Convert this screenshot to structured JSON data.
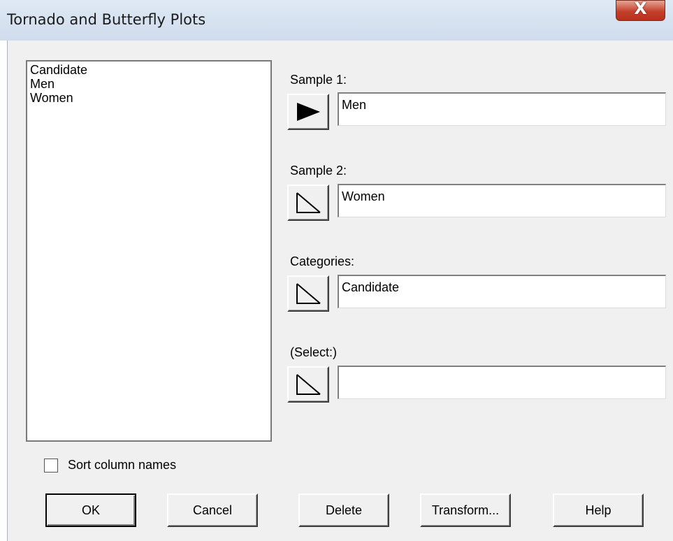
{
  "window": {
    "title": "Tornado and Butterfly Plots",
    "close_glyph": "X"
  },
  "columns_list": {
    "items": [
      "Candidate",
      "Men",
      "Women"
    ]
  },
  "fields": {
    "sample1": {
      "label": "Sample 1:",
      "value": "Men",
      "arrow_icon": "filled-arrow-icon"
    },
    "sample2": {
      "label": "Sample 2:",
      "value": "Women",
      "arrow_icon": "outline-arrow-icon"
    },
    "categories": {
      "label": "Categories:",
      "value": "Candidate",
      "arrow_icon": "outline-arrow-icon"
    },
    "select": {
      "label": "(Select:)",
      "value": "",
      "arrow_icon": "outline-arrow-icon"
    }
  },
  "sort_checkbox": {
    "label": "Sort column names",
    "checked": false
  },
  "buttons": {
    "ok": "OK",
    "cancel": "Cancel",
    "delete": "Delete",
    "transform": "Transform...",
    "help": "Help"
  }
}
